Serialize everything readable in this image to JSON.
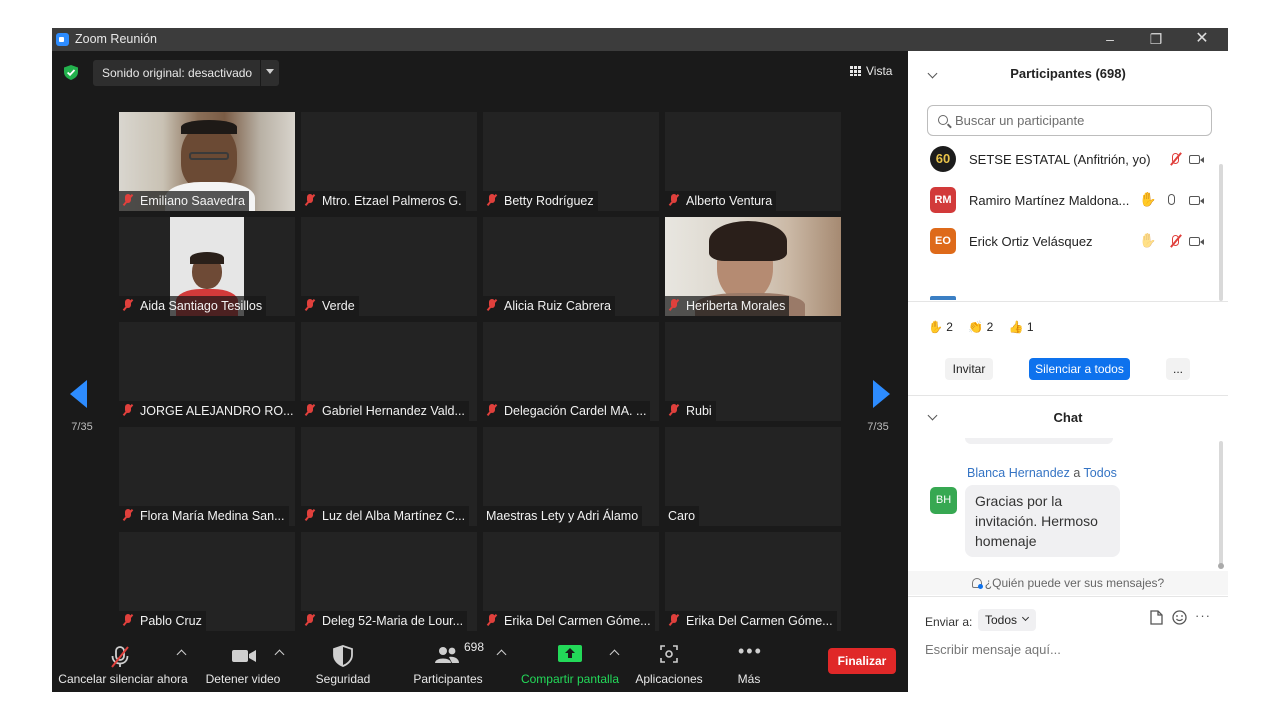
{
  "window": {
    "title": "Zoom Reunión"
  },
  "top_bar": {
    "sound_original": "Sonido original: desactivado",
    "view_label": "Vista"
  },
  "pager": {
    "left": "7/35",
    "right": "7/35"
  },
  "participants_grid": [
    {
      "name": "Emiliano Saavedra",
      "muted": true,
      "video": true
    },
    {
      "name": "Mtro. Etzael Palmeros G.",
      "muted": true,
      "video": false
    },
    {
      "name": "Betty Rodríguez",
      "muted": true,
      "video": false
    },
    {
      "name": "Alberto Ventura",
      "muted": true,
      "video": false
    },
    {
      "name": "Aida Santiago Tesillos",
      "muted": true,
      "video": true
    },
    {
      "name": "Verde",
      "muted": true,
      "video": false
    },
    {
      "name": "Alicia Ruiz Cabrera",
      "muted": true,
      "video": false
    },
    {
      "name": "Heriberta Morales",
      "muted": true,
      "video": true
    },
    {
      "name": "JORGE ALEJANDRO RO...",
      "muted": true,
      "video": false
    },
    {
      "name": "Gabriel Hernandez Vald...",
      "muted": true,
      "video": false
    },
    {
      "name": "Delegación  Cardel MA. ...",
      "muted": true,
      "video": false
    },
    {
      "name": "Rubi",
      "muted": true,
      "video": false
    },
    {
      "name": "Flora María Medina San...",
      "muted": true,
      "video": false
    },
    {
      "name": "Luz del Alba Martínez C...",
      "muted": true,
      "video": false
    },
    {
      "name": "Maestras Lety y Adri Álamo",
      "muted": false,
      "video": false
    },
    {
      "name": "Caro",
      "muted": false,
      "video": false
    },
    {
      "name": "Pablo Cruz",
      "muted": true,
      "video": false
    },
    {
      "name": "Deleg 52-Maria de Lour...",
      "muted": true,
      "video": false
    },
    {
      "name": "Erika Del Carmen Góme...",
      "muted": true,
      "video": false
    },
    {
      "name": "Erika Del Carmen Góme...",
      "muted": true,
      "video": false
    }
  ],
  "toolbar": {
    "unmute": "Cancelar silenciar ahora",
    "stop_video": "Detener video",
    "security": "Seguridad",
    "participants": "Participantes",
    "participants_count": "698",
    "share_screen": "Compartir pantalla",
    "apps": "Aplicaciones",
    "more": "Más",
    "end": "Finalizar"
  },
  "participants_panel": {
    "title": "Participantes (698)",
    "search_placeholder": "Buscar un participante",
    "list": [
      {
        "initials": "60",
        "name": "SETSE ESTATAL (Anfitrión, yo)",
        "color": "#1c1c1c"
      },
      {
        "initials": "RM",
        "name": "Ramiro Martínez Maldona...",
        "color": "#d23a3a"
      },
      {
        "initials": "EO",
        "name": "Erick Ortiz Velásquez",
        "color": "#de6a1a"
      }
    ],
    "reactions": {
      "raise_hand": "2",
      "clap": "2",
      "thumbs_up": "1"
    },
    "invite": "Invitar",
    "mute_all": "Silenciar a todos",
    "more": "..."
  },
  "chat": {
    "title": "Chat",
    "message": {
      "sender": "Blanca Hernandez",
      "to_word": "a",
      "to": "Todos",
      "initials": "BH",
      "text": "Gracias por la invitación. Hermoso homenaje"
    },
    "who_sees": "¿Quién puede ver sus mensajes?",
    "send_to_label": "Enviar a:",
    "send_to_value": "Todos",
    "input_placeholder": "Escribir mensaje aquí..."
  },
  "colors": {
    "accent_blue": "#2d8cff",
    "end_red": "#e02828",
    "share_green": "#23d959",
    "mute_red": "#e0403c"
  }
}
